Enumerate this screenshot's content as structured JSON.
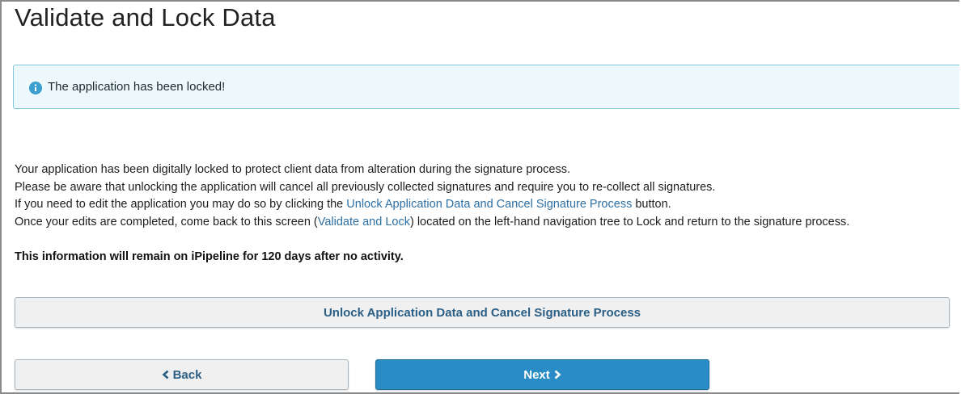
{
  "page": {
    "title": "Validate and Lock Data"
  },
  "alert": {
    "icon": "info-icon",
    "message": "The application has been locked!",
    "color_accent": "#7ec8db",
    "background": "#ecf8fc"
  },
  "content": {
    "line1": "Your application has been digitally locked to protect client data from alteration during the signature process.",
    "line2": "Please be aware that unlocking the application will cancel all previously collected signatures and require you to re-collect all signatures.",
    "line3_pre": "If you need to edit the application you may do so by clicking the ",
    "line3_link": "Unlock Application Data and Cancel Signature Process",
    "line3_post": " button.",
    "line4_pre": "Once your edits are completed, come back to this screen (",
    "line4_link": "Validate and Lock",
    "line4_post": ") located on the left-hand navigation tree to Lock and return to the signature process.",
    "notice": "This information will remain on iPipeline for 120 days after no activity."
  },
  "buttons": {
    "unlock_label": "Unlock Application Data and Cancel Signature Process",
    "back_label": "Back",
    "back_icon": "chevron-left-icon",
    "next_label": "Next",
    "next_icon": "chevron-right-icon"
  },
  "colors": {
    "primary": "#2a8cc4",
    "link": "#2d6fa3"
  }
}
